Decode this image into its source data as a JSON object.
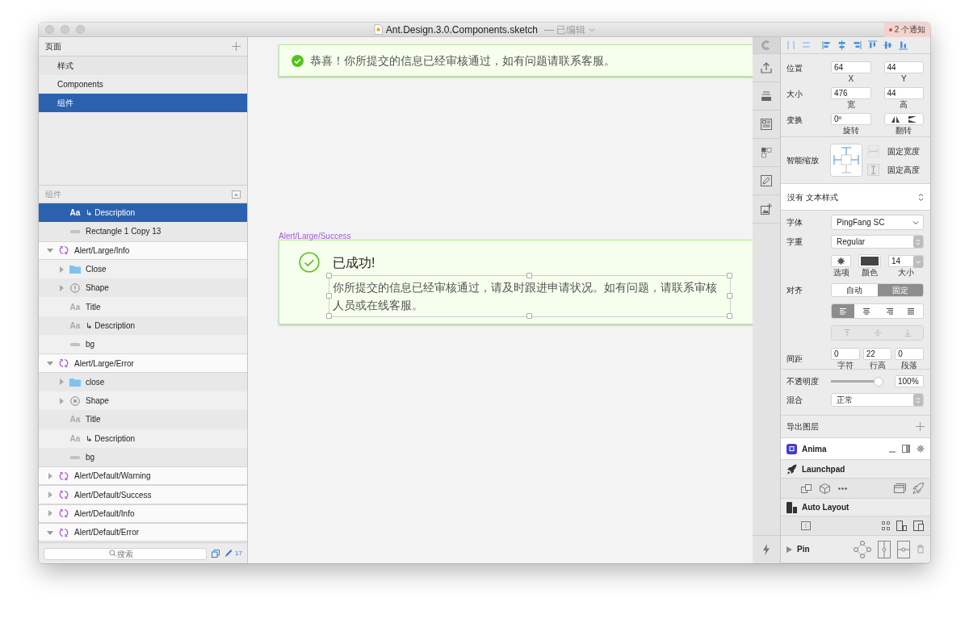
{
  "window": {
    "title": "Ant.Design.3.0.Components.sketch",
    "edited": "— 已编辑",
    "notification": "2 个通知"
  },
  "pages": {
    "header": "页面",
    "items": [
      {
        "label": "样式",
        "selected": false
      },
      {
        "label": "Components",
        "selected": false
      },
      {
        "label": "组件",
        "selected": true
      }
    ]
  },
  "layers": {
    "header": "组件",
    "items": [
      {
        "children": [
          {
            "kind": "text",
            "icon": "Aa",
            "label": "↳ Description",
            "selected": true
          },
          {
            "kind": "rectangle",
            "label": "Rectangle 1 Copy 13",
            "selected": false
          }
        ]
      },
      {
        "kind": "symbol",
        "label": "Alert/Large/Info",
        "expanded": true,
        "selected": false,
        "children": [
          {
            "kind": "folder",
            "label": "Close",
            "expanded": false,
            "selected": false
          },
          {
            "kind": "info-shape",
            "label": "Shape",
            "expanded": false,
            "selected": false
          },
          {
            "kind": "text",
            "icon": "Aa",
            "label": "Title",
            "selected": false
          },
          {
            "kind": "text",
            "icon": "Aa",
            "label": "↳ Description",
            "selected": false
          },
          {
            "kind": "rectangle",
            "label": "bg",
            "selected": false
          }
        ]
      },
      {
        "kind": "symbol",
        "label": "Alert/Large/Error",
        "expanded": true,
        "selected": false,
        "children": [
          {
            "kind": "folder",
            "label": "close",
            "expanded": false,
            "selected": false
          },
          {
            "kind": "error-shape",
            "label": "Shape",
            "expanded": false,
            "selected": false
          },
          {
            "kind": "text",
            "icon": "Aa",
            "label": "Title",
            "selected": false
          },
          {
            "kind": "text",
            "icon": "Aa",
            "label": "↳ Description",
            "selected": false
          },
          {
            "kind": "rectangle",
            "label": "bg",
            "selected": false
          }
        ]
      },
      {
        "kind": "symbol",
        "label": "Alert/Default/Warning",
        "expanded": false,
        "selected": false
      },
      {
        "kind": "symbol",
        "label": "Alert/Default/Success",
        "expanded": false,
        "selected": false
      },
      {
        "kind": "symbol",
        "label": "Alert/Default/Info",
        "expanded": false,
        "selected": false
      },
      {
        "kind": "symbol",
        "label": "Alert/Default/Error",
        "expanded": true,
        "selected": false
      }
    ]
  },
  "search": {
    "placeholder": "搜索",
    "count": "17"
  },
  "canvas": {
    "alert": {
      "text": "恭喜！你所提交的信息已经审核通过，如有问题请联系客服。"
    },
    "large_alert": {
      "label": "Alert/Large/Success",
      "title": "已成功!",
      "description": "你所提交的信息已经审核通过，请及时跟进申请状况。如有问题，请联系审核人员或在线客服。"
    }
  },
  "inspector": {
    "position": {
      "label": "位置",
      "fields": [
        {
          "value": "64",
          "caption": "X"
        },
        {
          "value": "44",
          "caption": "Y"
        }
      ]
    },
    "size": {
      "label": "大小",
      "fields": [
        {
          "value": "476",
          "caption": "宽"
        },
        {
          "value": "44",
          "caption": "高"
        }
      ]
    },
    "transform": {
      "label": "变换",
      "rotation": {
        "value": "0º",
        "caption": "旋转"
      },
      "flip_caption": "翻转"
    },
    "resizing": {
      "label": "智能缩放",
      "options": [
        {
          "label": "固定宽度",
          "disabled": true
        },
        {
          "label": "固定高度",
          "disabled": false
        }
      ]
    },
    "text_style": "没有 文本样式",
    "font": {
      "label": "字体",
      "value": "PingFang SC"
    },
    "weight": {
      "label": "字重",
      "value": "Regular"
    },
    "font_controls": {
      "options_caption": "选项",
      "color_caption": "颜色",
      "size": "14",
      "size_caption": "大小"
    },
    "alignment": {
      "label": "对齐",
      "modes": [
        {
          "label": "自动",
          "selected": false
        },
        {
          "label": "固定",
          "selected": true
        }
      ],
      "horizontal": [
        {
          "kind": "left",
          "selected": true
        },
        {
          "kind": "center",
          "selected": false
        },
        {
          "kind": "right",
          "selected": false
        },
        {
          "kind": "justify",
          "selected": false
        }
      ],
      "vertical_disabled": true
    },
    "spacing": {
      "label": "间距",
      "fields": [
        {
          "value": "0",
          "caption": "字符"
        },
        {
          "value": "22",
          "caption": "行高"
        },
        {
          "value": "0",
          "caption": "段落"
        }
      ]
    },
    "opacity": {
      "label": "不透明度",
      "level": 1,
      "reading": "100%"
    },
    "blending": {
      "label": "混合",
      "value": "正常"
    },
    "export": {
      "label": "导出图层"
    },
    "plugins": [
      {
        "kind": "anima",
        "name": "Anima"
      },
      {
        "kind": "launchpad",
        "name": "Launchpad"
      },
      {
        "kind": "autolayout",
        "name": "Auto Layout"
      },
      {
        "kind": "pin",
        "name": "Pin",
        "expanded": false
      }
    ]
  }
}
